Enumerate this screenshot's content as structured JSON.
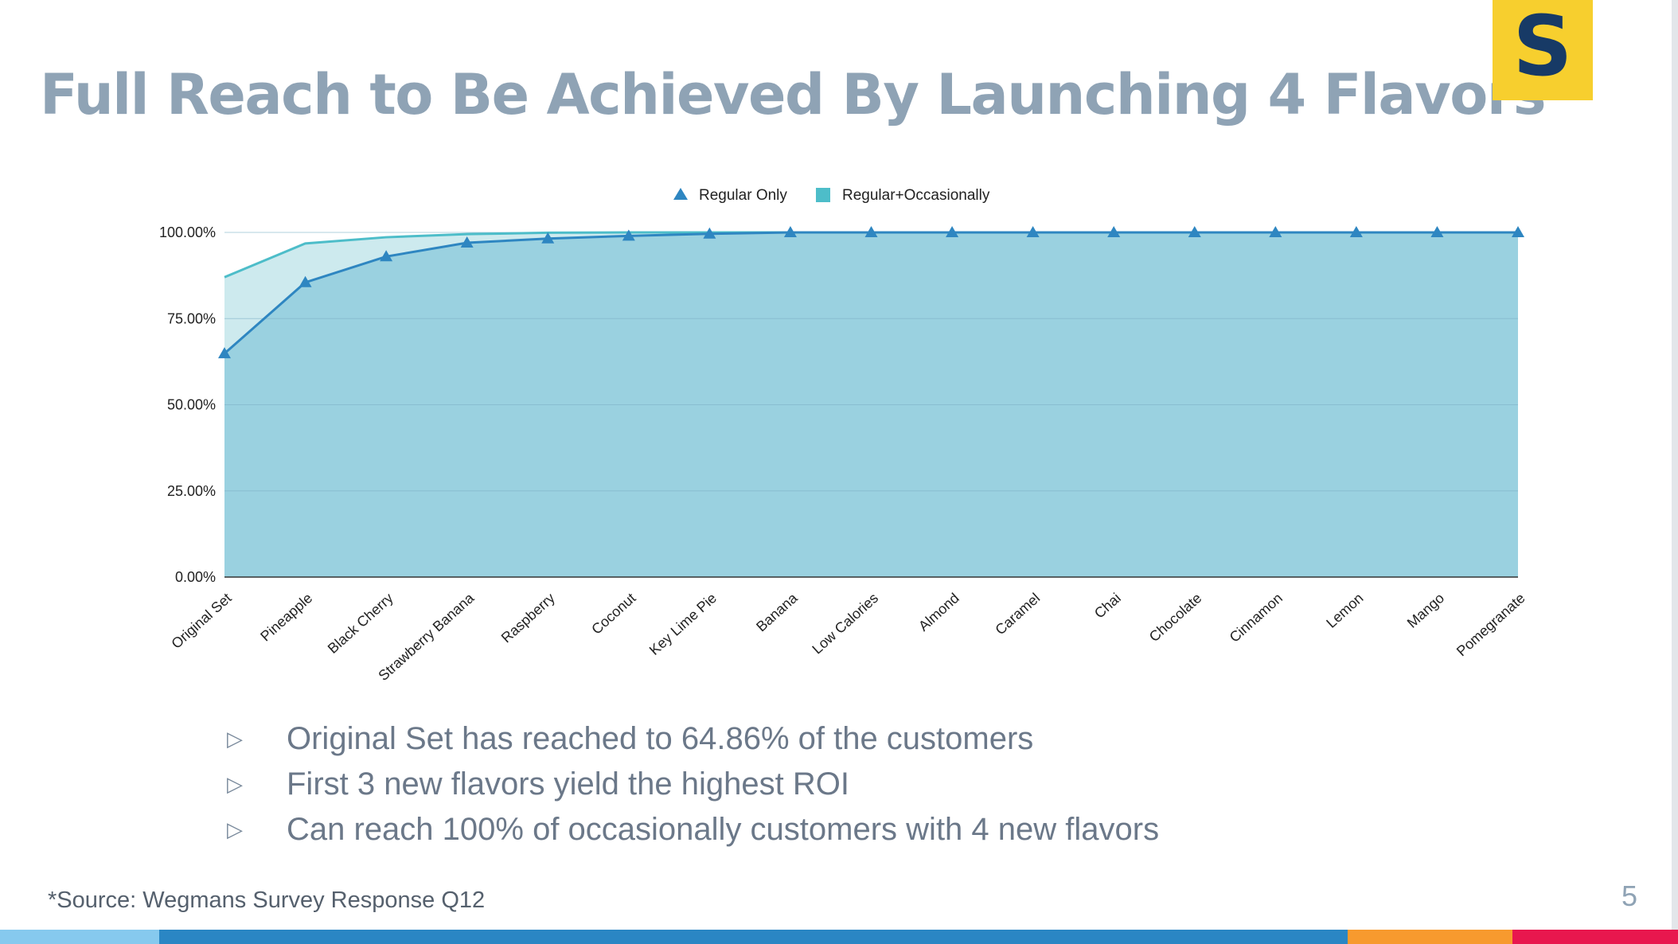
{
  "slide": {
    "title": "Full Reach to Be Achieved By Launching 4 Flavors",
    "logo_text": "S",
    "bullets": [
      "Original Set has reached to 64.86% of the customers",
      "First 3 new flavors yield the highest ROI",
      "Can reach 100% of occasionally customers with 4 new flavors"
    ],
    "bullet_marker": "▷",
    "source": "*Source:  Wegmans Survey Response Q12",
    "page_number": "5",
    "colors": {
      "title": "#8fa3b5",
      "logo_bg": "#f7cf2e",
      "logo_letter": "#173a66",
      "footer_bar": [
        "#86c9ee",
        "#2a86c4",
        "#f79a2e",
        "#e8174e"
      ]
    }
  },
  "chart_data": {
    "type": "area",
    "title": "",
    "xlabel": "",
    "ylabel": "",
    "ylim": [
      0,
      100
    ],
    "y_ticks": [
      "0.00%",
      "25.00%",
      "50.00%",
      "75.00%",
      "100.00%"
    ],
    "legend_position": "top",
    "grid": true,
    "categories": [
      "Original Set",
      "Pineapple",
      "Black Cherry",
      "Strawberry Banana",
      "Raspberry",
      "Coconut",
      "Key Lime Pie",
      "Banana",
      "Low Calories",
      "Almond",
      "Caramel",
      "Chai",
      "Chocolate",
      "Cinnamon",
      "Lemon",
      "Mango",
      "Pomegranate"
    ],
    "series": [
      {
        "name": "Regular Only",
        "color": "#2e86c1",
        "fill": "#9ad1e0",
        "marker": "triangle",
        "values": [
          64.86,
          85.5,
          93.0,
          97.0,
          98.2,
          99.0,
          99.6,
          100,
          100,
          100,
          100,
          100,
          100,
          100,
          100,
          100,
          100
        ]
      },
      {
        "name": "Regular+Occasionally",
        "color": "#4dbdc9",
        "fill": "#cdeaee",
        "marker": "square",
        "values": [
          87.0,
          96.8,
          98.6,
          99.5,
          99.9,
          100,
          100,
          100,
          100,
          100,
          100,
          100,
          100,
          100,
          100,
          100,
          100
        ]
      }
    ]
  }
}
